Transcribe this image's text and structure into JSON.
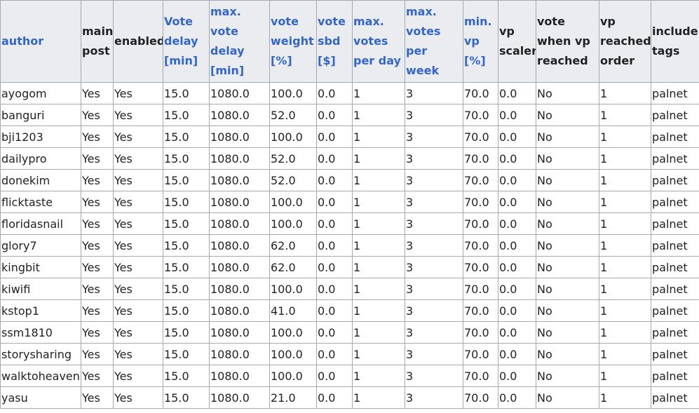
{
  "table": {
    "columns": [
      {
        "label": "author",
        "link": true,
        "width": 115
      },
      {
        "label": "main post",
        "link": false,
        "width": 46
      },
      {
        "label": "enabled",
        "link": false,
        "width": 71
      },
      {
        "label": "Vote delay [min]",
        "link": true,
        "width": 66
      },
      {
        "label": "max. vote delay [min]",
        "link": true,
        "width": 86
      },
      {
        "label": "vote weight [%]",
        "link": true,
        "width": 67
      },
      {
        "label": "vote sbd [$]",
        "link": true,
        "width": 51
      },
      {
        "label": "max. votes per day",
        "link": true,
        "width": 75
      },
      {
        "label": "max. votes per week",
        "link": true,
        "width": 83
      },
      {
        "label": "min. vp [%]",
        "link": true,
        "width": 50
      },
      {
        "label": "vp scaler",
        "link": false,
        "width": 54
      },
      {
        "label": "vote when vp reached",
        "link": false,
        "width": 90
      },
      {
        "label": "vp reached order",
        "link": false,
        "width": 74
      },
      {
        "label": "include tags",
        "link": false,
        "width": 69
      }
    ],
    "rows": [
      [
        "ayogom",
        "Yes",
        "Yes",
        "15.0",
        "1080.0",
        "100.0",
        "0.0",
        "1",
        "3",
        "70.0",
        "0.0",
        "No",
        "1",
        "palnet"
      ],
      [
        "banguri",
        "Yes",
        "Yes",
        "15.0",
        "1080.0",
        "52.0",
        "0.0",
        "1",
        "3",
        "70.0",
        "0.0",
        "No",
        "1",
        "palnet"
      ],
      [
        "bji1203",
        "Yes",
        "Yes",
        "15.0",
        "1080.0",
        "100.0",
        "0.0",
        "1",
        "3",
        "70.0",
        "0.0",
        "No",
        "1",
        "palnet"
      ],
      [
        "dailypro",
        "Yes",
        "Yes",
        "15.0",
        "1080.0",
        "52.0",
        "0.0",
        "1",
        "3",
        "70.0",
        "0.0",
        "No",
        "1",
        "palnet"
      ],
      [
        "donekim",
        "Yes",
        "Yes",
        "15.0",
        "1080.0",
        "52.0",
        "0.0",
        "1",
        "3",
        "70.0",
        "0.0",
        "No",
        "1",
        "palnet"
      ],
      [
        "flicktaste",
        "Yes",
        "Yes",
        "15.0",
        "1080.0",
        "100.0",
        "0.0",
        "1",
        "3",
        "70.0",
        "0.0",
        "No",
        "1",
        "palnet"
      ],
      [
        "floridasnail",
        "Yes",
        "Yes",
        "15.0",
        "1080.0",
        "100.0",
        "0.0",
        "1",
        "3",
        "70.0",
        "0.0",
        "No",
        "1",
        "palnet"
      ],
      [
        "glory7",
        "Yes",
        "Yes",
        "15.0",
        "1080.0",
        "62.0",
        "0.0",
        "1",
        "3",
        "70.0",
        "0.0",
        "No",
        "1",
        "palnet"
      ],
      [
        "kingbit",
        "Yes",
        "Yes",
        "15.0",
        "1080.0",
        "62.0",
        "0.0",
        "1",
        "3",
        "70.0",
        "0.0",
        "No",
        "1",
        "palnet"
      ],
      [
        "kiwifi",
        "Yes",
        "Yes",
        "15.0",
        "1080.0",
        "100.0",
        "0.0",
        "1",
        "3",
        "70.0",
        "0.0",
        "No",
        "1",
        "palnet"
      ],
      [
        "kstop1",
        "Yes",
        "Yes",
        "15.0",
        "1080.0",
        "41.0",
        "0.0",
        "1",
        "3",
        "70.0",
        "0.0",
        "No",
        "1",
        "palnet"
      ],
      [
        "ssm1810",
        "Yes",
        "Yes",
        "15.0",
        "1080.0",
        "100.0",
        "0.0",
        "1",
        "3",
        "70.0",
        "0.0",
        "No",
        "1",
        "palnet"
      ],
      [
        "storysharing",
        "Yes",
        "Yes",
        "15.0",
        "1080.0",
        "100.0",
        "0.0",
        "1",
        "3",
        "70.0",
        "0.0",
        "No",
        "1",
        "palnet"
      ],
      [
        "walktoheaven",
        "Yes",
        "Yes",
        "15.0",
        "1080.0",
        "100.0",
        "0.0",
        "1",
        "3",
        "70.0",
        "0.0",
        "No",
        "1",
        "palnet"
      ],
      [
        "yasu",
        "Yes",
        "Yes",
        "15.0",
        "1080.0",
        "21.0",
        "0.0",
        "1",
        "3",
        "70.0",
        "0.0",
        "No",
        "1",
        "palnet"
      ]
    ]
  },
  "colors": {
    "header_bg": "#eaecf0",
    "link_text": "#3366cc",
    "text": "#222222",
    "border": "#a2a9b1"
  }
}
